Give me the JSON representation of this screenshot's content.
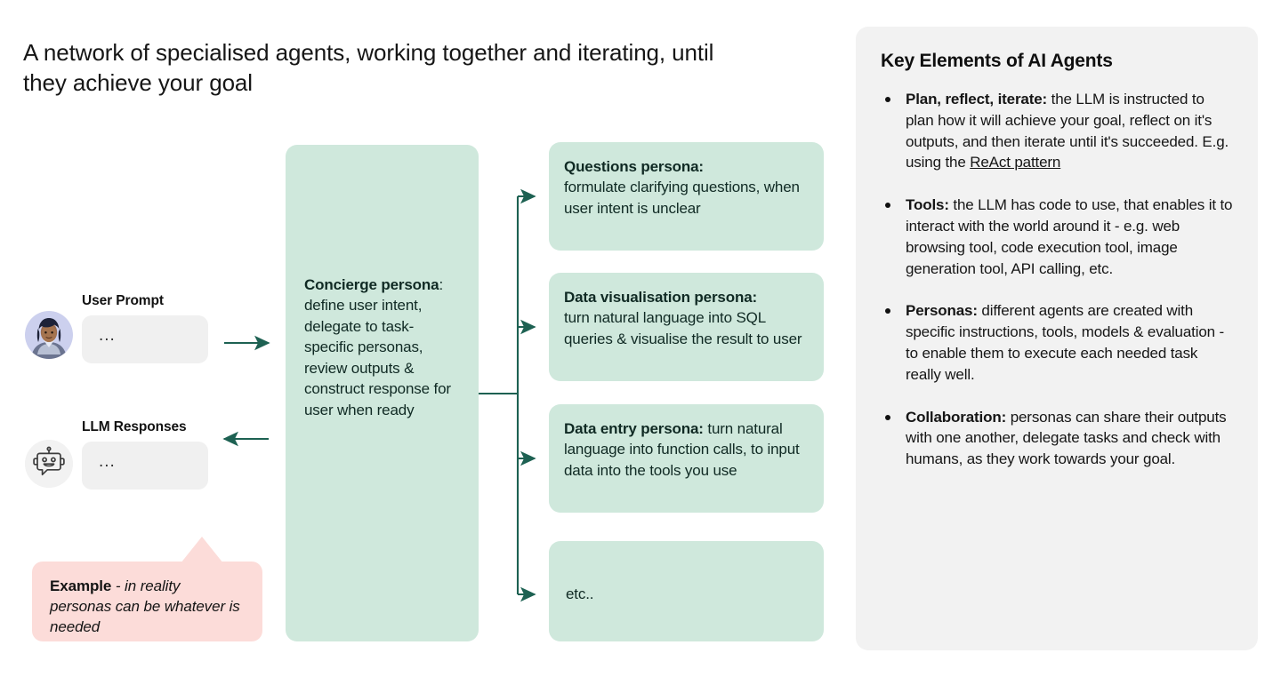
{
  "title": "A network of specialised agents, working together and iterating, until they achieve your goal",
  "left_column": {
    "user_prompt": {
      "label": "User Prompt",
      "value": "...",
      "avatar_icon": "user-avatar-photo-icon"
    },
    "llm_responses": {
      "label": "LLM Responses",
      "value": "...",
      "avatar_icon": "robot-chat-bubble-icon"
    }
  },
  "example_callout": {
    "bold": "Example",
    "separator": " - ",
    "italic": "in reality personas can be whatever is needed"
  },
  "flow": {
    "concierge": {
      "heading": "Concierge persona",
      "heading_suffix": ":",
      "body": "define user intent, delegate to task-specific personas, review outputs & construct response for user when ready"
    },
    "branches": [
      {
        "heading": "Questions persona:",
        "body": "formulate clarifying questions, when user intent is unclear"
      },
      {
        "heading": "Data visualisation persona:",
        "body": "turn natural language into SQL queries & visualise the result to user"
      },
      {
        "heading": "Data entry persona:",
        "body": " turn natural language into function calls, to input data into the tools you use"
      },
      {
        "heading": "",
        "body": "etc.."
      }
    ]
  },
  "key_panel": {
    "heading": "Key Elements of AI Agents",
    "items": [
      {
        "term": "Plan, reflect, iterate:",
        "text": " the LLM is instructed to plan how it will achieve your goal, reflect on it's outputs, and then iterate until it's succeeded. E.g. using the ",
        "link": "ReAct pattern",
        "tail": ""
      },
      {
        "term": "Tools:",
        "text": " the LLM has code to use, that enables it to interact with the world around it - e.g. web browsing tool, code execution tool, image generation tool, API calling, etc.",
        "link": "",
        "tail": ""
      },
      {
        "term": "Personas:",
        "text": " different agents are created with specific instructions, tools, models & evaluation - to enable them to execute each needed task really well.",
        "link": "",
        "tail": ""
      },
      {
        "term": "Collaboration:",
        "text": " personas can share their outputs with one another, delegate tasks and check with humans, as they work towards your goal.",
        "link": "",
        "tail": ""
      }
    ]
  },
  "colors": {
    "mint": "#cfe8dc",
    "pink": "#fcdcd9",
    "panel_gray": "#f2f2f2",
    "pill_gray": "#f0f0f0",
    "arrow_teal": "#1d6152",
    "text": "#161616"
  }
}
